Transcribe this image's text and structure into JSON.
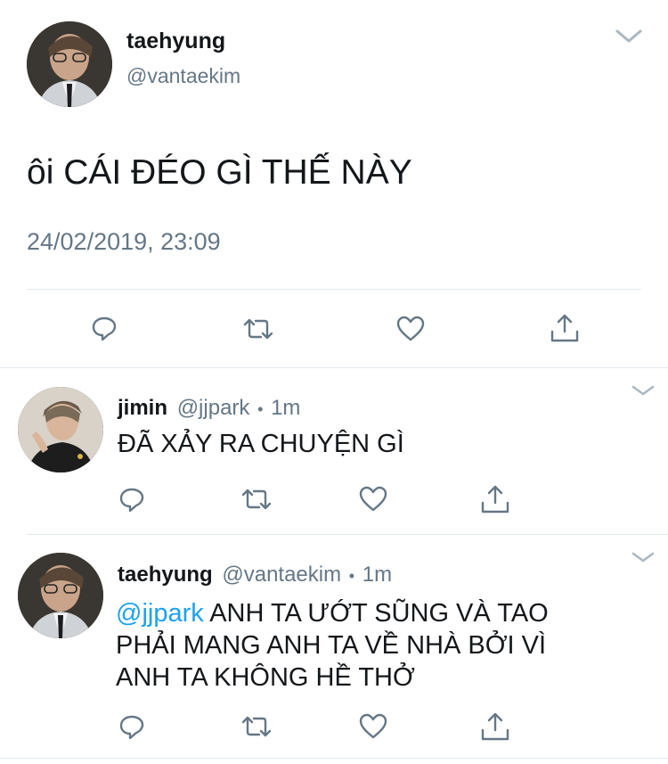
{
  "main_tweet": {
    "name": "taehyung",
    "handle": "@vantaekim",
    "text": "ôi CÁI ĐÉO GÌ THẾ NÀY",
    "timestamp": "24/02/2019, 23:09"
  },
  "replies": [
    {
      "name": "jimin",
      "handle": "@jjpark",
      "dot": "•",
      "time": "1m",
      "text": "ĐÃ XẢY RA CHUYỆN GÌ"
    },
    {
      "name": "taehyung",
      "handle": "@vantaekim",
      "dot": "•",
      "time": "1m",
      "mention": "@jjpark",
      "text_line1": " ANH TA ƯỚT SŨNG VÀ TAO",
      "text_line2": "PHẢI MANG ANH TA VỀ NHÀ BỞI VÌ",
      "text_line3": "ANH TA KHÔNG HỀ THỞ"
    }
  ],
  "icons": [
    "reply-icon",
    "retweet-icon",
    "like-icon",
    "share-icon",
    "chevron-down-icon"
  ],
  "colors": {
    "text": "#14171a",
    "secondary": "#657786",
    "link": "#1da1f2",
    "icon": "#657786",
    "divider": "#e1e8ed"
  }
}
